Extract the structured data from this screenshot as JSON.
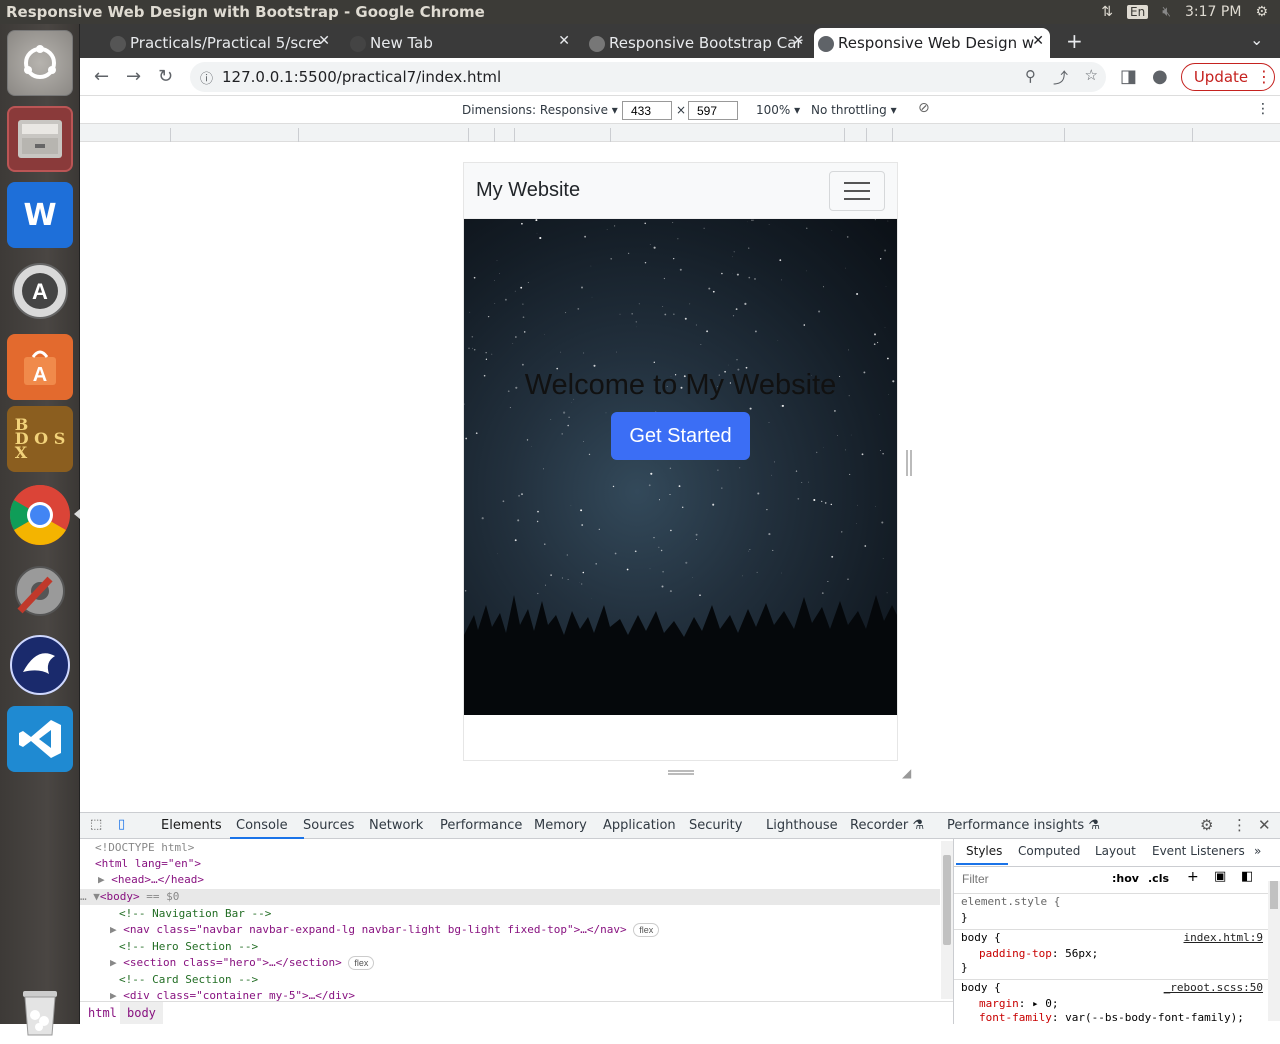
{
  "system_bar": {
    "window_title": "Responsive Web Design with Bootstrap - Google Chrome",
    "lang": "En",
    "clock": "3:17 PM"
  },
  "launcher": {
    "items": [
      "files-icon",
      "wps-writer-icon",
      "software-updater-icon",
      "ubuntu-software-icon",
      "dosbox-icon",
      "chrome-icon",
      "system-settings-icon",
      "thunderbird-icon",
      "vscode-icon",
      "trash-icon"
    ]
  },
  "tabs": [
    {
      "label": "Practicals/Practical 5/scre",
      "icon": "github-icon"
    },
    {
      "label": "New Tab",
      "icon": "chrome-icon"
    },
    {
      "label": "Responsive Bootstrap Car",
      "icon": "globe-icon"
    },
    {
      "label": "Responsive Web Design w",
      "icon": "globe-icon"
    }
  ],
  "toolbar": {
    "url": "127.0.0.1:5500/practical7/index.html",
    "update_label": "Update"
  },
  "device_toolbar": {
    "dimensions_label": "Dimensions: Responsive",
    "width": "433",
    "height": "597",
    "zoom": "100%",
    "throttling": "No throttling",
    "times": "×"
  },
  "page": {
    "brand": "My Website",
    "hero_title": "Welcome to My Website",
    "cta_label": "Get Started"
  },
  "devtools": {
    "tabs": [
      "Elements",
      "Console",
      "Sources",
      "Network",
      "Performance",
      "Memory",
      "Application",
      "Security",
      "Lighthouse",
      "Recorder",
      "Performance insights"
    ],
    "dom": {
      "doctype": "<!DOCTYPE html>",
      "html_open": "<html lang=\"en\">",
      "head": "<head>…</head>",
      "body": "<body>",
      "body_suffix": " == $0",
      "c_nav": "<!-- Navigation Bar -->",
      "nav": "<nav class=\"navbar navbar-expand-lg navbar-light bg-light fixed-top\">…</nav>",
      "c_hero": "<!-- Hero Section -->",
      "section": "<section class=\"hero\">…</section>",
      "c_card": "<!-- Card Section -->",
      "div": "<div class=\"container my-5\">…</div>",
      "flex": "flex"
    },
    "breadcrumb": [
      "html",
      "body"
    ],
    "styles_tabs": [
      "Styles",
      "Computed",
      "Layout",
      "Event Listeners"
    ],
    "filter_placeholder": "Filter",
    "hov": ":hov",
    "cls": ".cls",
    "rules": {
      "element_style": "element.style {",
      "close": "}",
      "body1_sel": "body {",
      "body1_src": "index.html:9",
      "body1_prop": "padding-top",
      "body1_val": ": 56px;",
      "body2_sel": "body {",
      "body2_src": "_reboot.scss:50",
      "body2_prop1": "margin",
      "body2_val1": ": ▸ 0;",
      "body2_prop2": "font-family",
      "body2_val2": ": var(--bs-body-font-family);"
    }
  }
}
